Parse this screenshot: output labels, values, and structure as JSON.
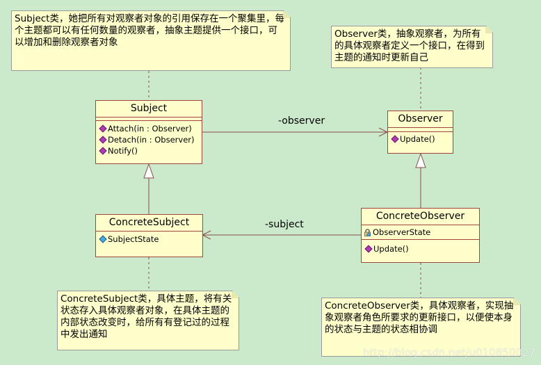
{
  "notes": {
    "subject": "Subject类，她把所有对观察者对象的引用保存在一个聚集里，每个主题都可以有任何数量的观察者，抽象主题提供一个接口，可以增加和删除观察者对象",
    "observer": "Observer类，抽象观察者，为所有的具体观察者定义一个接口，在得到主题的通知时更新自己",
    "concrete_subject": "ConcreteSubject类，具体主题，将有关状态存入具体观察者对象，在具体主题的内部状态改变时，给所有有登记过的过程中发出通知",
    "concrete_observer": "ConcreteObserver类，具体观察者，实现抽象观察者角色所要求的更新接口，以便使本身的状态与主题的状态相协调"
  },
  "classes": {
    "subject": {
      "name": "Subject",
      "operations": [
        "Attach(in : Observer)",
        "Detach(in : Observer)",
        "Notify()"
      ]
    },
    "observer": {
      "name": "Observer",
      "operations": [
        "Update()"
      ]
    },
    "concrete_subject": {
      "name": "ConcreteSubject",
      "attributes": [
        "SubjectState"
      ]
    },
    "concrete_observer": {
      "name": "ConcreteObserver",
      "attributes": [
        "ObserverState"
      ],
      "operations": [
        "Update()"
      ]
    }
  },
  "associations": {
    "subject_to_observer": "-observer",
    "observer_to_subject": "-subject"
  },
  "watermark": "http://blog.csdn.net/u010850027",
  "colors": {
    "background": "#cbeacb",
    "box_fill": "#ffffcc",
    "class_border": "#a0433e",
    "operation_icon": "#b03cb3",
    "attribute_icon": "#4aa8e0"
  }
}
